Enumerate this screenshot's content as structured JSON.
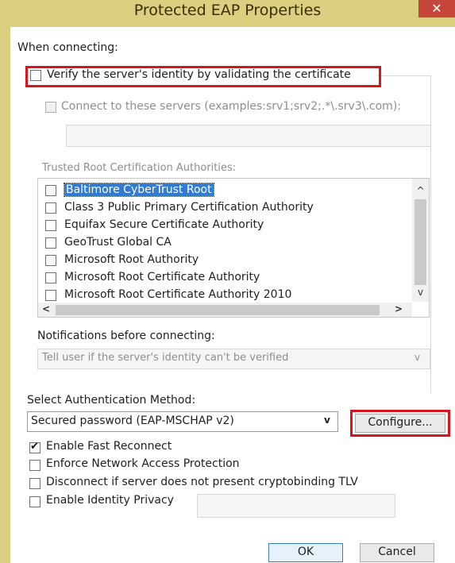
{
  "window": {
    "title": "Protected EAP Properties",
    "close_glyph": "✕"
  },
  "connecting": {
    "heading": "When connecting:",
    "verify_label": "Verify the server's identity by validating the certificate",
    "verify_checked": false,
    "connect_servers_label": "Connect to these servers (examples:srv1;srv2;.*\\.srv3\\.com):",
    "servers_value": ""
  },
  "trusted_ca": {
    "heading": "Trusted Root Certification Authorities:",
    "items": [
      {
        "label": "Baltimore CyberTrust Root",
        "checked": false,
        "selected": true
      },
      {
        "label": "Class 3 Public Primary Certification Authority",
        "checked": false,
        "selected": false
      },
      {
        "label": "Equifax Secure Certificate Authority",
        "checked": false,
        "selected": false
      },
      {
        "label": "GeoTrust Global CA",
        "checked": false,
        "selected": false
      },
      {
        "label": "Microsoft Root Authority",
        "checked": false,
        "selected": false
      },
      {
        "label": "Microsoft Root Certificate Authority",
        "checked": false,
        "selected": false
      },
      {
        "label": "Microsoft Root Certificate Authority 2010",
        "checked": false,
        "selected": false
      }
    ],
    "scroll_up": "^",
    "scroll_down": "v",
    "scroll_left": "<",
    "scroll_right": ">"
  },
  "notifications": {
    "heading": "Notifications before connecting:",
    "value": "Tell user if the server's identity can't be verified",
    "arrow": "v"
  },
  "auth": {
    "heading": "Select Authentication Method:",
    "method_value": "Secured password (EAP-MSCHAP v2)",
    "dropdown_arrow": "v",
    "configure_label": "Configure..."
  },
  "options": {
    "fast_reconnect": {
      "label": "Enable Fast Reconnect",
      "checked": true
    },
    "nap": {
      "label": "Enforce Network Access Protection",
      "checked": false
    },
    "cryptobinding": {
      "label": "Disconnect if server does not present cryptobinding TLV",
      "checked": false
    },
    "identity_privacy": {
      "label": "Enable Identity Privacy",
      "checked": false
    },
    "identity_value": ""
  },
  "buttons": {
    "ok": "OK",
    "cancel": "Cancel"
  },
  "colors": {
    "frame": "#dccf7f",
    "highlight_red": "#d5161e",
    "selection_blue": "#2f7bd6"
  }
}
